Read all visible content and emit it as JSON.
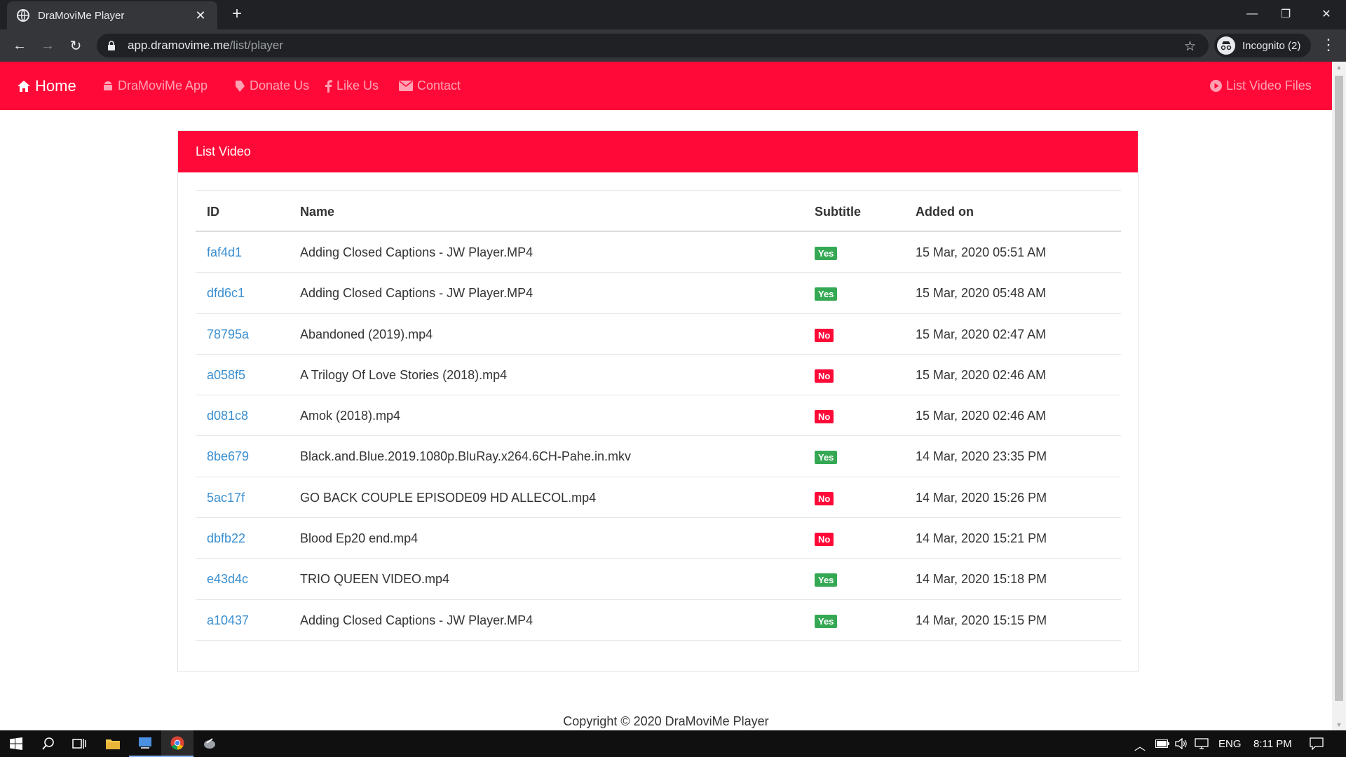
{
  "browser": {
    "tab_title": "DraMoviMe Player",
    "url_host": "app.dramovime.me",
    "url_path": "/list/player",
    "profile_label": "Incognito (2)"
  },
  "nav": {
    "brand": "Home",
    "links": [
      {
        "label": "DraMoviMe App",
        "icon": "android-icon"
      },
      {
        "label": "Donate Us",
        "icon": "tag-icon"
      },
      {
        "label": "Like Us",
        "icon": "facebook-icon"
      },
      {
        "label": "Contact",
        "icon": "envelope-icon"
      }
    ],
    "right_link": {
      "label": "List Video Files",
      "icon": "play-circle-icon"
    }
  },
  "card": {
    "title": "List Video",
    "columns": [
      "ID",
      "Name",
      "Subtitle",
      "Added on"
    ],
    "rows": [
      {
        "id": "faf4d1",
        "name": "Adding Closed Captions - JW Player.MP4",
        "subtitle": "Yes",
        "added": "15 Mar, 2020 05:51 AM"
      },
      {
        "id": "dfd6c1",
        "name": "Adding Closed Captions - JW Player.MP4",
        "subtitle": "Yes",
        "added": "15 Mar, 2020 05:48 AM"
      },
      {
        "id": "78795a",
        "name": "Abandoned (2019).mp4",
        "subtitle": "No",
        "added": "15 Mar, 2020 02:47 AM"
      },
      {
        "id": "a058f5",
        "name": "A Trilogy Of Love Stories (2018).mp4",
        "subtitle": "No",
        "added": "15 Mar, 2020 02:46 AM"
      },
      {
        "id": "d081c8",
        "name": "Amok (2018).mp4",
        "subtitle": "No",
        "added": "15 Mar, 2020 02:46 AM"
      },
      {
        "id": "8be679",
        "name": "Black.and.Blue.2019.1080p.BluRay.x264.6CH-Pahe.in.mkv",
        "subtitle": "Yes",
        "added": "14 Mar, 2020 23:35 PM"
      },
      {
        "id": "5ac17f",
        "name": "GO BACK COUPLE EPISODE09 HD ALLECOL.mp4",
        "subtitle": "No",
        "added": "14 Mar, 2020 15:26 PM"
      },
      {
        "id": "dbfb22",
        "name": "Blood Ep20 end.mp4",
        "subtitle": "No",
        "added": "14 Mar, 2020 15:21 PM"
      },
      {
        "id": "e43d4c",
        "name": "TRIO QUEEN VIDEO.mp4",
        "subtitle": "Yes",
        "added": "14 Mar, 2020 15:18 PM"
      },
      {
        "id": "a10437",
        "name": "Adding Closed Captions - JW Player.MP4",
        "subtitle": "Yes",
        "added": "14 Mar, 2020 15:15 PM"
      }
    ]
  },
  "footer": {
    "text": "Copyright © 2020 DraMoviMe Player"
  },
  "taskbar": {
    "language": "ENG",
    "time": "8:11 PM"
  },
  "colors": {
    "brand_red": "#ff0a38",
    "link_blue": "#3a8fd1",
    "badge_green": "#34a853"
  }
}
